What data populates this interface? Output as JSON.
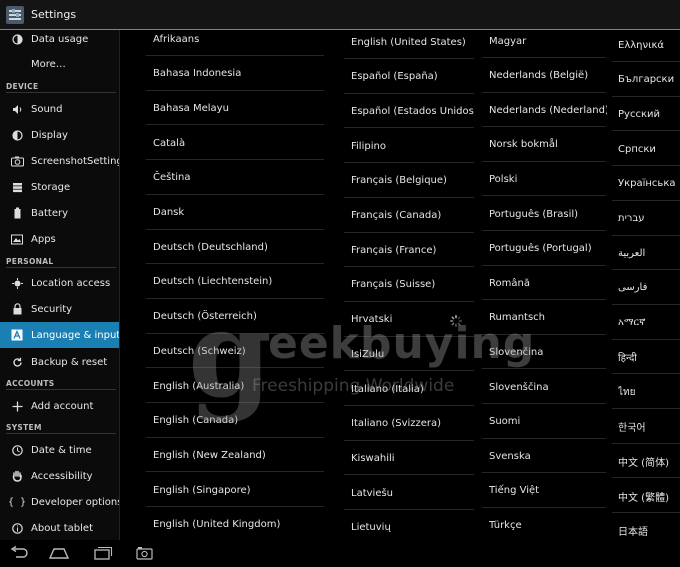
{
  "app": {
    "title": "Settings"
  },
  "sidebar": {
    "items": [
      {
        "label": "Data usage",
        "icon": "data-usage-icon"
      },
      {
        "label": "More…",
        "icon": ""
      },
      {
        "label": "Sound",
        "icon": "speaker-icon"
      },
      {
        "label": "Display",
        "icon": "display-icon"
      },
      {
        "label": "ScreenshotSetting",
        "icon": "camera-icon"
      },
      {
        "label": "Storage",
        "icon": "storage-icon"
      },
      {
        "label": "Battery",
        "icon": "battery-icon"
      },
      {
        "label": "Apps",
        "icon": "apps-icon"
      },
      {
        "label": "Location access",
        "icon": "location-icon"
      },
      {
        "label": "Security",
        "icon": "lock-icon"
      },
      {
        "label": "Language & input",
        "icon": "language-icon"
      },
      {
        "label": "Backup & reset",
        "icon": "backup-icon"
      },
      {
        "label": "Add account",
        "icon": "plus-icon"
      },
      {
        "label": "Date & time",
        "icon": "clock-icon"
      },
      {
        "label": "Accessibility",
        "icon": "hand-icon"
      },
      {
        "label": "Developer options",
        "icon": "braces-icon"
      },
      {
        "label": "About tablet",
        "icon": "info-icon"
      }
    ],
    "sections": {
      "device": "DEVICE",
      "personal": "PERSONAL",
      "accounts": "ACCOUNTS",
      "system": "SYSTEM"
    },
    "active_item": "Language & input"
  },
  "languages": {
    "col1": [
      "Afrikaans",
      "Bahasa Indonesia",
      "Bahasa Melayu",
      "Català",
      "Čeština",
      "Dansk",
      "Deutsch (Deutschland)",
      "Deutsch (Liechtenstein)",
      "Deutsch (Österreich)",
      "Deutsch (Schweiz)",
      "English (Australia)",
      "English (Canada)",
      "English (New Zealand)",
      "English (Singapore)",
      "English (United Kingdom)"
    ],
    "col2": [
      "English (United States)",
      "Español (España)",
      "Español (Estados Unidos)",
      "Filipino",
      "Français (Belgique)",
      "Français (Canada)",
      "Français (France)",
      "Français (Suisse)",
      "Hrvatski",
      "IsiZulu",
      "Italiano (Italia)",
      "Italiano (Svizzera)",
      "Kiswahili",
      "Latviešu",
      "Lietuvių"
    ],
    "col3": [
      "Magyar",
      "Nederlands (België)",
      "Nederlands (Nederland)",
      "Norsk bokmål",
      "Polski",
      "Português (Brasil)",
      "Português (Portugal)",
      "Română",
      "Rumantsch",
      "Slovenčina",
      "Slovenščina",
      "Suomi",
      "Svenska",
      "Tiếng Việt",
      "Türkçe"
    ],
    "col4": [
      "Ελληνικά",
      "Български",
      "Русский",
      "Српски",
      "Українська",
      "עברית",
      "العربية",
      "فارسی",
      "አማርኛ",
      "हिन्दी",
      "ไทย",
      "한국어",
      "中文 (简体)",
      "中文 (繁體)",
      "日本語"
    ]
  },
  "watermark": {
    "letter": "g",
    "brand": "eekbuying",
    "tagline": "Freeshipping Worldwide"
  },
  "navbar": {
    "buttons": [
      "back-icon",
      "home-icon",
      "recent-apps-icon",
      "screenshot-icon"
    ]
  },
  "colors": {
    "accent": "#1a7fb3",
    "actionbar_line": "#2a9fd6",
    "background": "#000000"
  }
}
